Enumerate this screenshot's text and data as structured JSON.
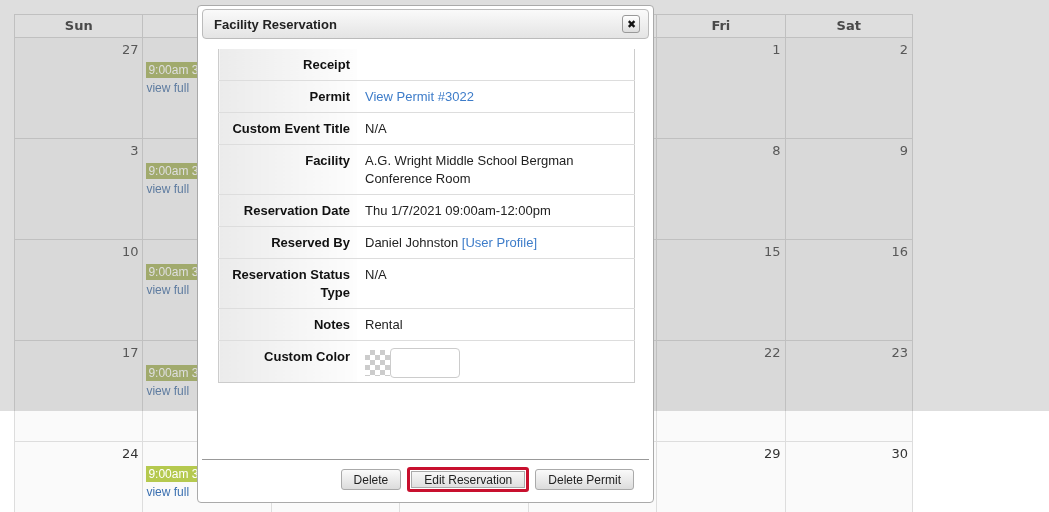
{
  "calendar": {
    "headers": {
      "sunday": "Sun",
      "friday": "Fri",
      "saturday": "Sat"
    },
    "weeks": [
      {
        "sunday": "27",
        "monday_event": "9:00am 3",
        "monday_link": "view full",
        "friday": "1",
        "saturday": "2",
        "dimmed": true
      },
      {
        "sunday": "3",
        "monday_event": "9:00am 3",
        "monday_link": "view full",
        "friday": "8",
        "saturday": "9",
        "dimmed": true
      },
      {
        "sunday": "10",
        "monday_event": "9:00am 3",
        "monday_link": "view full",
        "friday": "15",
        "saturday": "16",
        "dimmed": true
      },
      {
        "sunday": "17",
        "monday_event": "9:00am 3",
        "monday_link": "view full",
        "friday": "22",
        "saturday": "23",
        "dimmed": true
      },
      {
        "sunday": "24",
        "monday_event": "9:00am 3",
        "monday_link": "view full",
        "friday": "29",
        "saturday": "30",
        "dimmed": false
      }
    ]
  },
  "dialog": {
    "title": "Facility Reservation",
    "close": "✖",
    "rows": [
      {
        "label": "Receipt",
        "kind": "text"
      },
      {
        "label": "Permit",
        "kind": "link",
        "link": "View Permit #3022"
      },
      {
        "label": "Custom Event Title",
        "kind": "text",
        "value": "N/A"
      },
      {
        "label": "Facility",
        "kind": "text",
        "value": "A.G. Wright Middle School Bergman Conference Room"
      },
      {
        "label": "Reservation Date",
        "kind": "text",
        "value": "Thu 1/7/2021 09:00am-12:00pm"
      },
      {
        "label": "Reserved By",
        "kind": "text_link",
        "value": "Daniel Johnston",
        "link": "[User Profile]"
      },
      {
        "label": "Reservation Status Type",
        "kind": "text",
        "value": "N/A"
      },
      {
        "label": "Notes",
        "kind": "text",
        "value": "Rental"
      },
      {
        "label": "Custom Color",
        "kind": "color"
      }
    ],
    "buttons": [
      {
        "label": "Delete",
        "highlighted": false
      },
      {
        "label": "Edit Reservation",
        "highlighted": true
      },
      {
        "label": "Delete Permit",
        "highlighted": false
      }
    ]
  }
}
